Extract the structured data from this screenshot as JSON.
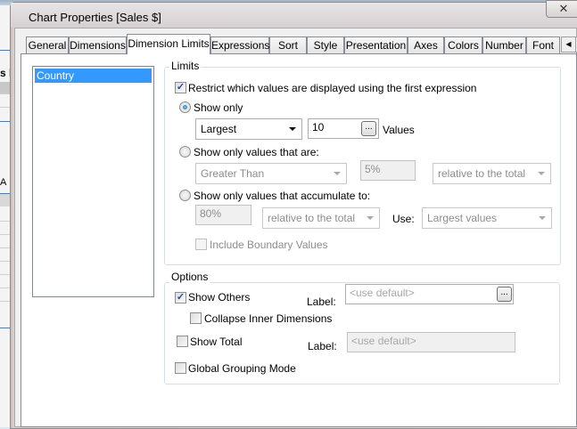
{
  "window": {
    "title": "Chart Properties [Sales $]",
    "close_label": "✕"
  },
  "background_app": {
    "fragment_1": "s le",
    "fragment_2": "A"
  },
  "tabs": [
    {
      "label": "General"
    },
    {
      "label": "Dimensions"
    },
    {
      "label": "Dimension Limits",
      "selected": true
    },
    {
      "label": "Expressions"
    },
    {
      "label": "Sort"
    },
    {
      "label": "Style"
    },
    {
      "label": "Presentation"
    },
    {
      "label": "Axes"
    },
    {
      "label": "Colors"
    },
    {
      "label": "Number"
    },
    {
      "label": "Font"
    }
  ],
  "tab_scroll": {
    "left": "◀",
    "right": "▶"
  },
  "dimensions_list": {
    "items": [
      "Country"
    ],
    "selected": "Country"
  },
  "limits": {
    "group_label": "Limits",
    "restrict_label": "Restrict which values are displayed using the first expression",
    "restrict_checked": true,
    "show_only": {
      "label": "Show only",
      "selected": true,
      "mode": "Largest",
      "count": "10",
      "ellipsis": "...",
      "suffix": "Values"
    },
    "show_values_that_are": {
      "label": "Show only values that are:",
      "selected": false,
      "comparison": "Greater Than",
      "value": "5%",
      "relative": "relative to the total"
    },
    "accumulate": {
      "label": "Show only values that accumulate to:",
      "selected": false,
      "value": "80%",
      "relative": "relative to the total",
      "use_label": "Use:",
      "use_value": "Largest values"
    },
    "include_boundary": {
      "label": "Include Boundary Values",
      "checked": false
    }
  },
  "options": {
    "group_label": "Options",
    "show_others": {
      "label": "Show Others",
      "checked": true,
      "field_label": "Label:",
      "placeholder": "<use default>",
      "ellipsis": "..."
    },
    "collapse_inner": {
      "label": "Collapse Inner Dimensions",
      "checked": false
    },
    "show_total": {
      "label": "Show Total",
      "checked": false,
      "field_label": "Label:",
      "placeholder": "<use default>"
    },
    "global_grouping": {
      "label": "Global Grouping Mode",
      "checked": false
    }
  },
  "colors": {
    "selection": "#3399ff",
    "group_border": "#d5dfe5",
    "dialog_bg": "#f0f0f0"
  }
}
